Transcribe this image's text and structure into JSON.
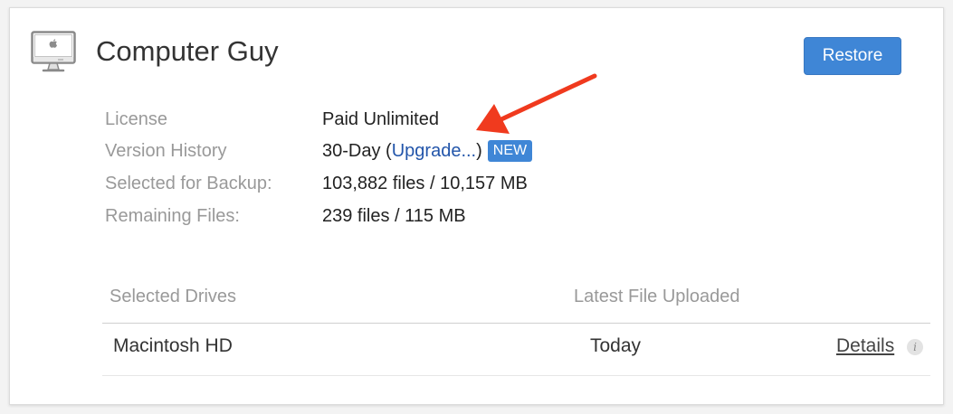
{
  "computer": {
    "name": "Computer Guy",
    "icon": "imac-computer-icon"
  },
  "actions": {
    "restore_label": "Restore"
  },
  "info": [
    {
      "label": "License",
      "value": "Paid Unlimited"
    },
    {
      "label": "Version History",
      "value": "30-Day"
    },
    {
      "label": "Selected for Backup:",
      "value": "103,882 files / 10,157 MB"
    },
    {
      "label": "Remaining Files:",
      "value": "239 files / 115 MB"
    }
  ],
  "version_history": {
    "open_paren": "(",
    "upgrade_label": "Upgrade...",
    "close_paren": ")",
    "badge": "NEW"
  },
  "drives_table": {
    "headers": [
      "Selected Drives",
      "Latest File Uploaded"
    ],
    "rows": [
      {
        "drive": "Macintosh HD",
        "latest": "Today",
        "details_label": "Details",
        "info_glyph": "i"
      }
    ]
  },
  "colors": {
    "accent": "#3f86d6",
    "link": "#2255aa",
    "annotation_arrow": "#f03a1e"
  }
}
